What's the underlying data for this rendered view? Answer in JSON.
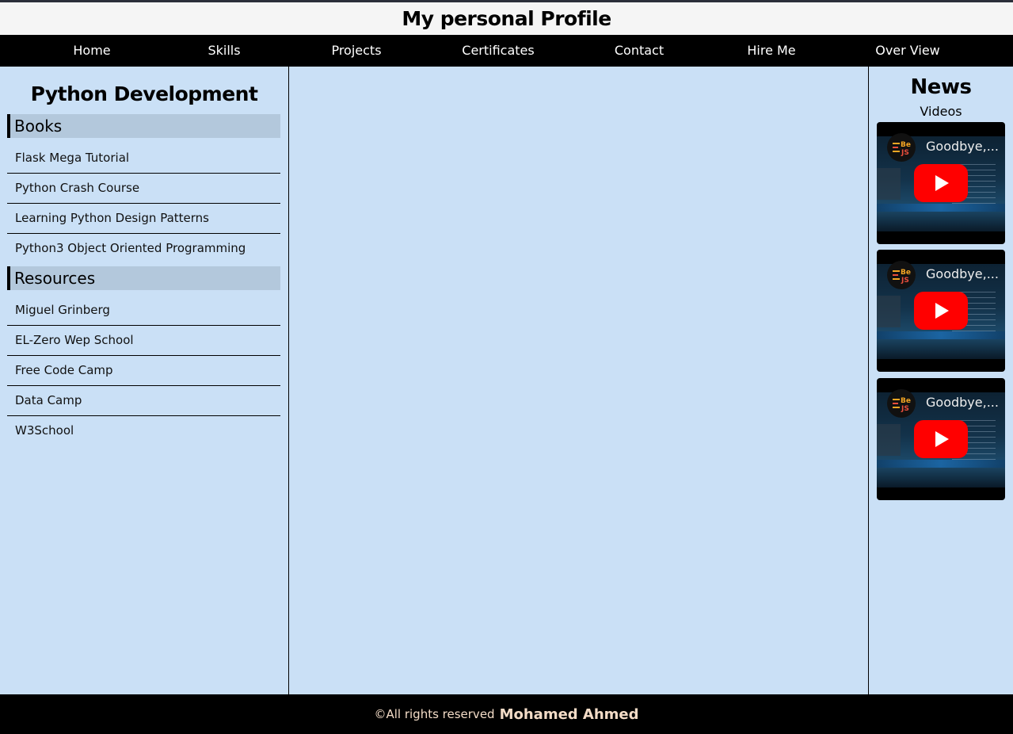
{
  "header": {
    "title": "My personal Profile"
  },
  "nav": {
    "items": [
      {
        "label": "Home"
      },
      {
        "label": "Skills"
      },
      {
        "label": "Projects"
      },
      {
        "label": "Certificates"
      },
      {
        "label": "Contact"
      },
      {
        "label": "Hire Me"
      },
      {
        "label": "Over View"
      }
    ]
  },
  "sidebar": {
    "title": "Python Development",
    "books_heading": "Books",
    "books": [
      {
        "label": "Flask Mega Tutorial"
      },
      {
        "label": "Python Crash Course"
      },
      {
        "label": "Learning Python Design Patterns"
      },
      {
        "label": "Python3 Object Oriented Programming"
      }
    ],
    "resources_heading": "Resources",
    "resources": [
      {
        "label": "Miguel Grinberg"
      },
      {
        "label": "EL-Zero Wep School"
      },
      {
        "label": "Free Code Camp"
      },
      {
        "label": "Data Camp"
      },
      {
        "label": "W3School"
      }
    ]
  },
  "news": {
    "title": "News",
    "videos_label": "Videos",
    "videos": [
      {
        "title": "Goodbye,...",
        "channel_icon": "bejs-logo-icon"
      },
      {
        "title": "Goodbye,...",
        "channel_icon": "bejs-logo-icon"
      },
      {
        "title": "Goodbye,...",
        "channel_icon": "bejs-logo-icon"
      }
    ]
  },
  "footer": {
    "rights": "©All rights reserved",
    "author": "Mohamed Ahmed"
  },
  "colors": {
    "page_bg": "#cae0f6",
    "nav_bg": "#000000",
    "section_head_bg": "#b3c8dc",
    "footer_text": "#f3dcc7",
    "play_button": "#ff0000"
  }
}
